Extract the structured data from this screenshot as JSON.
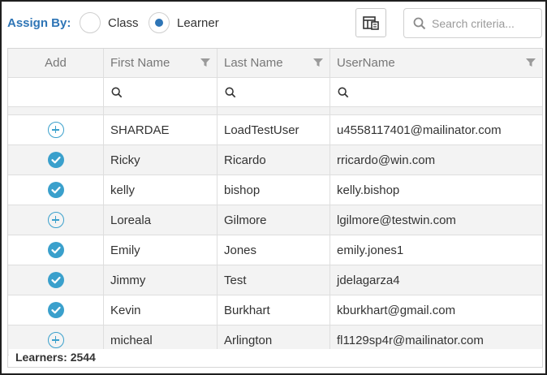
{
  "assign": {
    "label": "Assign By:",
    "options": [
      {
        "label": "Class",
        "selected": false
      },
      {
        "label": "Learner",
        "selected": true
      }
    ]
  },
  "toolbar": {
    "column_chooser_icon": "column-chooser-icon",
    "search_icon": "search-icon",
    "search_placeholder": "Search criteria...",
    "search_value": ""
  },
  "grid": {
    "columns": {
      "add": "Add",
      "first": "First Name",
      "last": "Last Name",
      "user": "UserName"
    },
    "filter_icon": "filter-icon",
    "rows": [
      {
        "status": "add",
        "first": "SHARDAE",
        "last": "LoadTestUser",
        "user": "u4558117401@mailinator.com"
      },
      {
        "status": "added",
        "first": "Ricky",
        "last": "Ricardo",
        "user": "rricardo@win.com"
      },
      {
        "status": "added",
        "first": "kelly",
        "last": "bishop",
        "user": "kelly.bishop"
      },
      {
        "status": "add",
        "first": "Loreala",
        "last": "Gilmore",
        "user": "lgilmore@testwin.com"
      },
      {
        "status": "added",
        "first": "Emily",
        "last": "Jones",
        "user": "emily.jones1"
      },
      {
        "status": "added",
        "first": "Jimmy",
        "last": "Test",
        "user": "jdelagarza4"
      },
      {
        "status": "added",
        "first": "Kevin",
        "last": "Burkhart",
        "user": "kburkhart@gmail.com"
      },
      {
        "status": "add",
        "first": "micheal",
        "last": "Arlington",
        "user": "fl1129sp4r@mailinator.com"
      }
    ]
  },
  "footer": {
    "count_text": "Learners: 2544"
  },
  "colors": {
    "accent": "#2e75b6",
    "icon": "#3aa0cc",
    "header_bg": "#f3f3f3",
    "stripe_bg": "#f3f3f3"
  }
}
